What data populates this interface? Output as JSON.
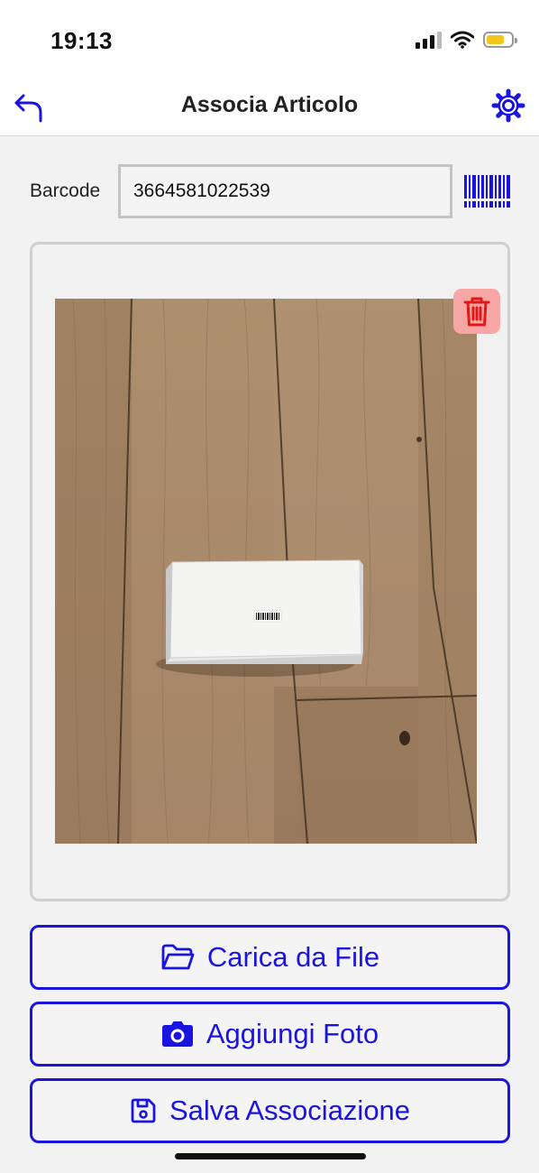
{
  "status_bar": {
    "time": "19:13"
  },
  "nav": {
    "title": "Associa Articolo",
    "back_icon": "undo-arrow-icon",
    "settings_icon": "gear-icon"
  },
  "barcode": {
    "label": "Barcode",
    "value": "3664581022539",
    "scan_icon": "barcode-scan-icon"
  },
  "photo": {
    "delete_icon": "trash-icon"
  },
  "buttons": {
    "upload": {
      "label": "Carica da File",
      "icon": "folder-icon"
    },
    "add_photo": {
      "label": "Aggiungi Foto",
      "icon": "camera-icon"
    },
    "save": {
      "label": "Salva Associazione",
      "icon": "floppy-disk-icon"
    }
  },
  "colors": {
    "accent": "#1a14e0",
    "delete_bg": "#f7a6a6",
    "delete_icon": "#e01818",
    "battery": "#f5c518"
  }
}
